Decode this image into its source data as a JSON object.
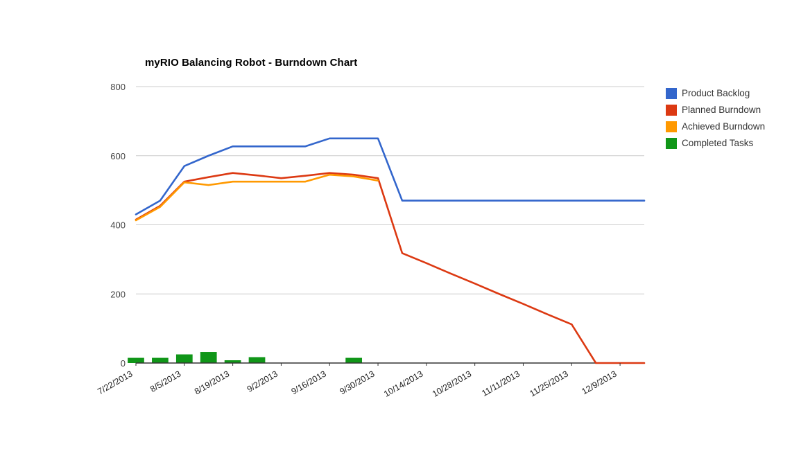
{
  "chart_data": {
    "type": "line",
    "title": "myRIO Balancing Robot - Burndown Chart",
    "xlabel": "",
    "ylabel": "",
    "ylim": [
      0,
      800
    ],
    "yticks": [
      0,
      200,
      400,
      600,
      800
    ],
    "grid": true,
    "legend_position": "right",
    "x": [
      "7/22/2013",
      "7/29/2013",
      "8/5/2013",
      "8/12/2013",
      "8/19/2013",
      "8/26/2013",
      "9/2/2013",
      "9/9/2013",
      "9/16/2013",
      "9/23/2013",
      "9/30/2013",
      "10/7/2013",
      "10/14/2013",
      "10/21/2013",
      "10/28/2013",
      "11/4/2013",
      "11/11/2013",
      "11/18/2013",
      "11/25/2013",
      "12/2/2013",
      "12/9/2013",
      "12/16/2013"
    ],
    "xtick_labels": [
      "7/22/2013",
      "8/5/2013",
      "8/19/2013",
      "9/2/2013",
      "9/16/2013",
      "9/30/2013",
      "10/14/2013",
      "10/28/2013",
      "11/11/2013",
      "11/25/2013",
      "12/9/2013"
    ],
    "series": [
      {
        "name": "Product Backlog",
        "type": "line",
        "color": "#3366cc",
        "values": [
          430,
          470,
          570,
          600,
          627,
          627,
          627,
          627,
          650,
          650,
          650,
          470,
          470,
          470,
          470,
          470,
          470,
          470,
          470,
          470,
          470,
          470
        ]
      },
      {
        "name": "Planned Burndown",
        "type": "line",
        "color": "#dc3912",
        "values": [
          415,
          455,
          525,
          538,
          550,
          543,
          535,
          542,
          550,
          545,
          535,
          318,
          289,
          259,
          230,
          200,
          171,
          141,
          112,
          0,
          0,
          0
        ]
      },
      {
        "name": "Achieved Burndown",
        "type": "line",
        "color": "#ff9900",
        "values": [
          413,
          452,
          523,
          515,
          525,
          525,
          525,
          525,
          545,
          540,
          528,
          null,
          null,
          null,
          null,
          null,
          null,
          null,
          null,
          null,
          null,
          null
        ]
      },
      {
        "name": "Completed Tasks",
        "type": "bar",
        "color": "#109618",
        "values": [
          15,
          15,
          25,
          32,
          8,
          17,
          0,
          0,
          0,
          15,
          0,
          0,
          0,
          0,
          0,
          0,
          0,
          0,
          0,
          0,
          0,
          0
        ]
      }
    ]
  },
  "legend": {
    "items": [
      {
        "label": "Product Backlog",
        "color": "#3366cc"
      },
      {
        "label": "Planned Burndown",
        "color": "#dc3912"
      },
      {
        "label": "Achieved Burndown",
        "color": "#ff9900"
      },
      {
        "label": "Completed Tasks",
        "color": "#109618"
      }
    ]
  }
}
